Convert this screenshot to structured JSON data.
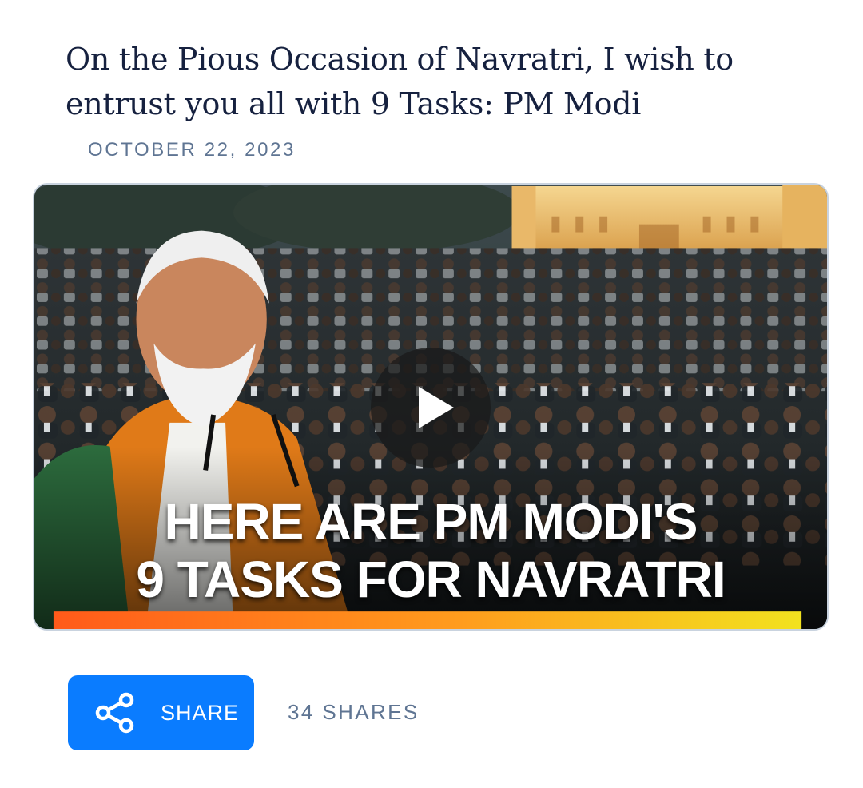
{
  "article": {
    "title": "On the Pious Occasion of Navratri, I wish to entrust you all with 9 Tasks: PM Modi",
    "date": "OCTOBER 22, 2023"
  },
  "video": {
    "caption_line1": "HERE ARE PM MODI'S",
    "caption_line2": "9 TASKS FOR NAVRATRI",
    "play_icon": "play-icon"
  },
  "share": {
    "button_label": "SHARE",
    "icon": "share-icon",
    "count_text": "34 SHARES",
    "button_color": "#0a7cff"
  }
}
